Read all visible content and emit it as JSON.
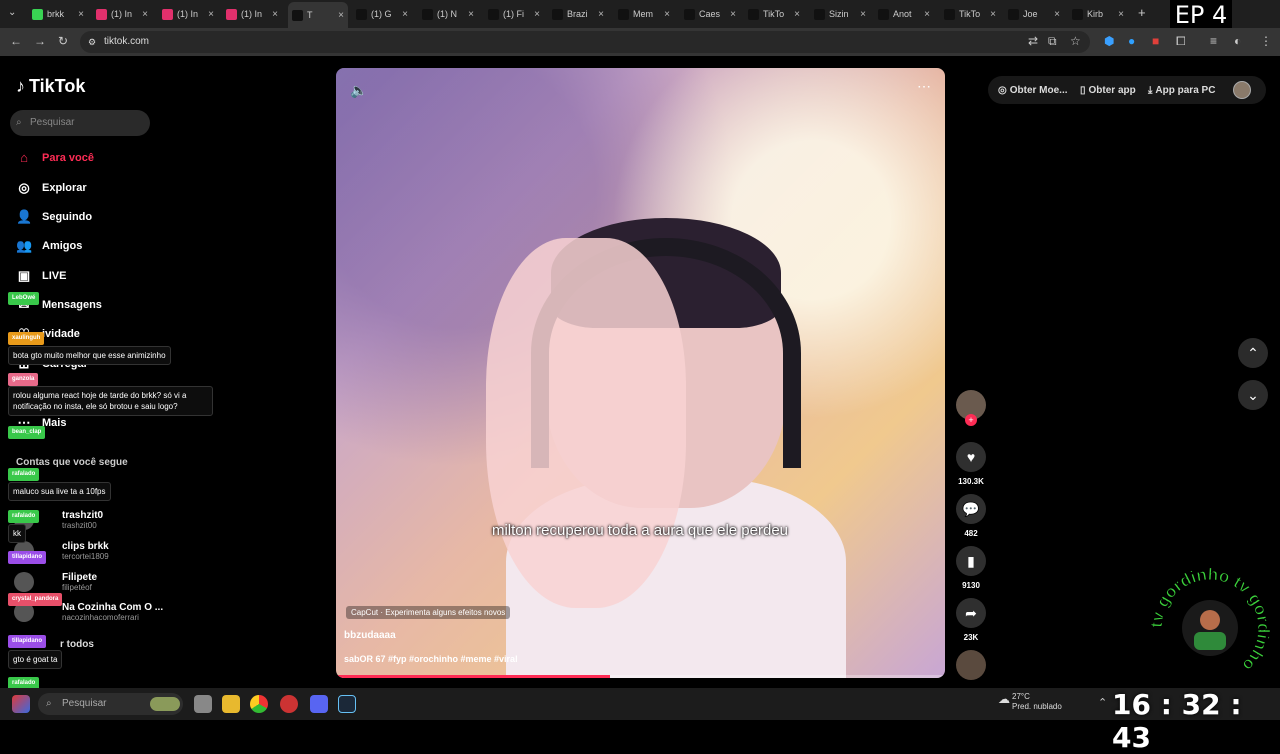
{
  "browser": {
    "tabs": [
      {
        "label": "brkk",
        "color": "#39d353"
      },
      {
        "label": "(1) In",
        "color": "#e1306c"
      },
      {
        "label": "(1) In",
        "color": "#e1306c"
      },
      {
        "label": "(1) In",
        "color": "#e1306c"
      },
      {
        "label": "T",
        "color": "#111111"
      },
      {
        "label": "(1) G",
        "color": "#111111"
      },
      {
        "label": "(1) N",
        "color": "#111111"
      },
      {
        "label": "(1) Fi",
        "color": "#111111"
      },
      {
        "label": "Brazi",
        "color": "#111111"
      },
      {
        "label": "Mem",
        "color": "#111111"
      },
      {
        "label": "Caes",
        "color": "#111111"
      },
      {
        "label": "TikTo",
        "color": "#111111"
      },
      {
        "label": "Sizin",
        "color": "#111111"
      },
      {
        "label": "Anot",
        "color": "#111111"
      },
      {
        "label": "TikTo",
        "color": "#111111"
      },
      {
        "label": "Joe",
        "color": "#111111"
      },
      {
        "label": "Kirb",
        "color": "#111111"
      }
    ],
    "url": "tiktok.com",
    "overlay_label": "EP 4"
  },
  "tiktok": {
    "logo": "TikTok",
    "search_placeholder": "Pesquisar",
    "nav": [
      {
        "label": "Para você",
        "icon": "home-icon"
      },
      {
        "label": "Explorar",
        "icon": "compass-icon"
      },
      {
        "label": "Seguindo",
        "icon": "following-icon"
      },
      {
        "label": "Amigos",
        "icon": "friends-icon"
      },
      {
        "label": "LIVE",
        "icon": "live-icon"
      },
      {
        "label": "Mensagens",
        "icon": "messages-icon"
      },
      {
        "label": "ividade",
        "icon": "activity-icon"
      },
      {
        "label": "Carregar",
        "icon": "upload-icon"
      },
      {
        "label": "Perfil",
        "icon": "profile-icon"
      },
      {
        "label": "Mais",
        "icon": "more-icon"
      }
    ],
    "following_title": "Contas que você segue",
    "accounts": [
      {
        "name": "trashzit0",
        "handle": "trashzit00"
      },
      {
        "name": "clips brkk",
        "handle": "tercortei1809"
      },
      {
        "name": "Filipete",
        "handle": "filipetéof"
      },
      {
        "name": "Na Cozinha Com O ...",
        "handle": "nacozinhacomoferrari"
      }
    ],
    "see_all": "r todos",
    "top_actions": [
      "Obter Moe...",
      "Obter app",
      "App para PC"
    ]
  },
  "chat": [
    {
      "user": "LebOwé",
      "user_color": "#39c84a",
      "message": ""
    },
    {
      "user": "xaulinguh",
      "user_color": "#e89a1a",
      "message": "bota gto muito melhor que esse animizinho"
    },
    {
      "user": "ganzola",
      "user_color": "#e86a8a",
      "message": "rolou alguma react hoje de tarde do brkk? só vi a notificação no insta, ele só brotou e saiu logo?"
    },
    {
      "user": "bean_clap",
      "user_color": "#39c84a",
      "message": ""
    },
    {
      "user": "rafalado",
      "user_color": "#39c84a",
      "message": "maluco sua live ta a 10fps"
    },
    {
      "user": "rafalado",
      "user_color": "#39c84a",
      "message": "kk"
    },
    {
      "user": "tillapidano",
      "user_color": "#9b4ee8",
      "message": ""
    },
    {
      "user": "crystal_pandora",
      "user_color": "#e8506a",
      "message": ""
    },
    {
      "user": "tillapidano",
      "user_color": "#9b4ee8",
      "message": "gto é goat ta"
    },
    {
      "user": "rafalado",
      "user_color": "#39c84a",
      "message": ""
    }
  ],
  "video": {
    "caption": "milton recuperou toda a aura que ele perdeu",
    "capcut_label": "CapCut · Experimenta alguns efeitos novos",
    "author": "bbzudaaaa",
    "description": "sabOR 67 #fyp #orochinho #meme #viral",
    "progress": 0.45,
    "likes": "130.3K",
    "comments": "482",
    "saves": "9130",
    "shares": "23K"
  },
  "taskbar": {
    "search_placeholder": "Pesquisar",
    "weather_temp": "27°C",
    "weather_text": "Pred. nublado",
    "clock": "16 : 32 : 43"
  },
  "watermark": {
    "text": "tv gordinho tv gordinho"
  }
}
